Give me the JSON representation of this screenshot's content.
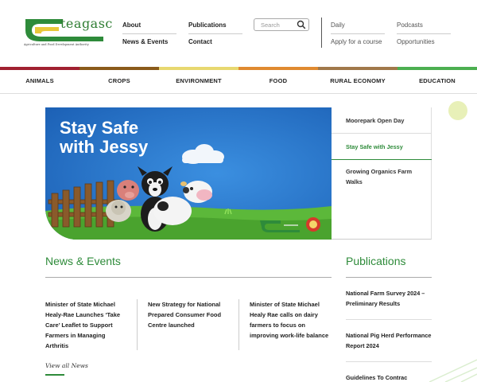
{
  "header": {
    "logo_word": "teagasc",
    "logo_subtitle": "Agriculture and Food Development Authority",
    "links_col1": [
      "About",
      "News & Events"
    ],
    "links_col2": [
      "Publications",
      "Contact"
    ],
    "search_placeholder": "Search",
    "links_col3": [
      "Daily",
      "Apply for a course"
    ],
    "links_col4": [
      "Podcasts",
      "Opportunities"
    ]
  },
  "nav": {
    "items": [
      {
        "label": "ANIMALS",
        "color": "#a02030"
      },
      {
        "label": "CROPS",
        "color": "#8a5a1a"
      },
      {
        "label": "ENVIRONMENT",
        "color": "#e8d870"
      },
      {
        "label": "FOOD",
        "color": "#e08a30"
      },
      {
        "label": "RURAL ECONOMY",
        "color": "#a0784a"
      },
      {
        "label": "EDUCATION",
        "color": "#4caf50"
      }
    ]
  },
  "hero": {
    "title": "Stay Safe with Jessy",
    "side_items": [
      {
        "label": "Moorepark Open Day",
        "active": false
      },
      {
        "label": "Stay Safe with Jessy",
        "active": true
      },
      {
        "label": "Growing Organics Farm Walks",
        "active": false
      }
    ]
  },
  "news": {
    "title": "News & Events",
    "items": [
      "Minister of State Michael Healy-Rae Launches ‘Take Care’ Leaflet to Support Farmers in Managing Arthritis",
      "New Strategy for National Prepared Consumer Food Centre launched",
      "Minister of State Michael Healy Rae calls on dairy farmers to focus on improving work-life balance"
    ],
    "view_all": "View all News"
  },
  "publications": {
    "title": "Publications",
    "items": [
      "National Farm Survey 2024 – Preliminary Results",
      "National Pig Herd Performance Report 2024",
      "Guidelines To Contrac"
    ]
  },
  "colors": {
    "brand_green": "#2e8b3a",
    "hero_blue": "#1f6fc5"
  }
}
